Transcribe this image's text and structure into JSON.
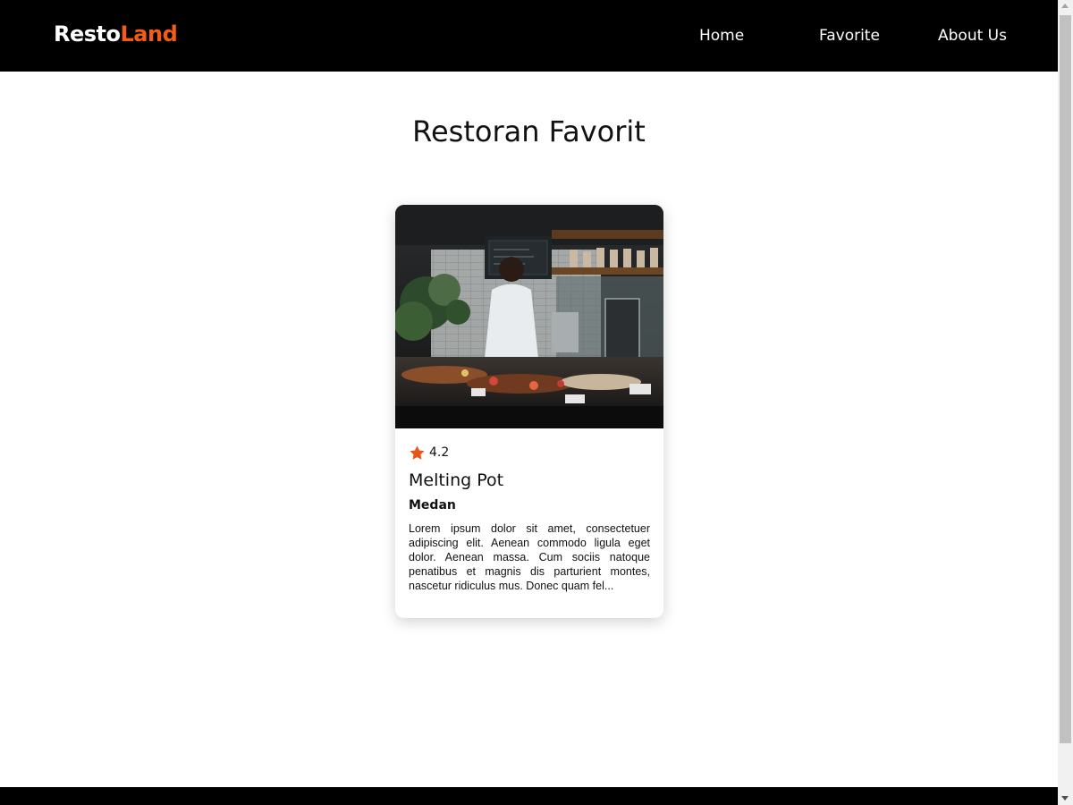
{
  "navbar": {
    "logo_part1": "Resto",
    "logo_part2": "Land",
    "links": [
      {
        "label": "Home"
      },
      {
        "label": "Favorite"
      },
      {
        "label": "About Us"
      }
    ]
  },
  "main": {
    "title": "Restoran Favorit",
    "restaurants": [
      {
        "rating": "4.2",
        "name": "Melting Pot",
        "city": "Medan",
        "description": "Lorem ipsum dolor sit amet, consectetuer adipiscing elit. Aenean commodo ligula eget dolor. Aenean massa. Cum sociis natoque penatibus et magnis dis parturient montes, nascetur ridiculus mus. Donec quam fel..."
      }
    ]
  },
  "colors": {
    "navbar_bg": "#000000",
    "accent": "#f25c14",
    "star": "#e8541a"
  },
  "icons": {
    "rating": "star-icon",
    "image": "restaurant-kitchen-photo"
  }
}
